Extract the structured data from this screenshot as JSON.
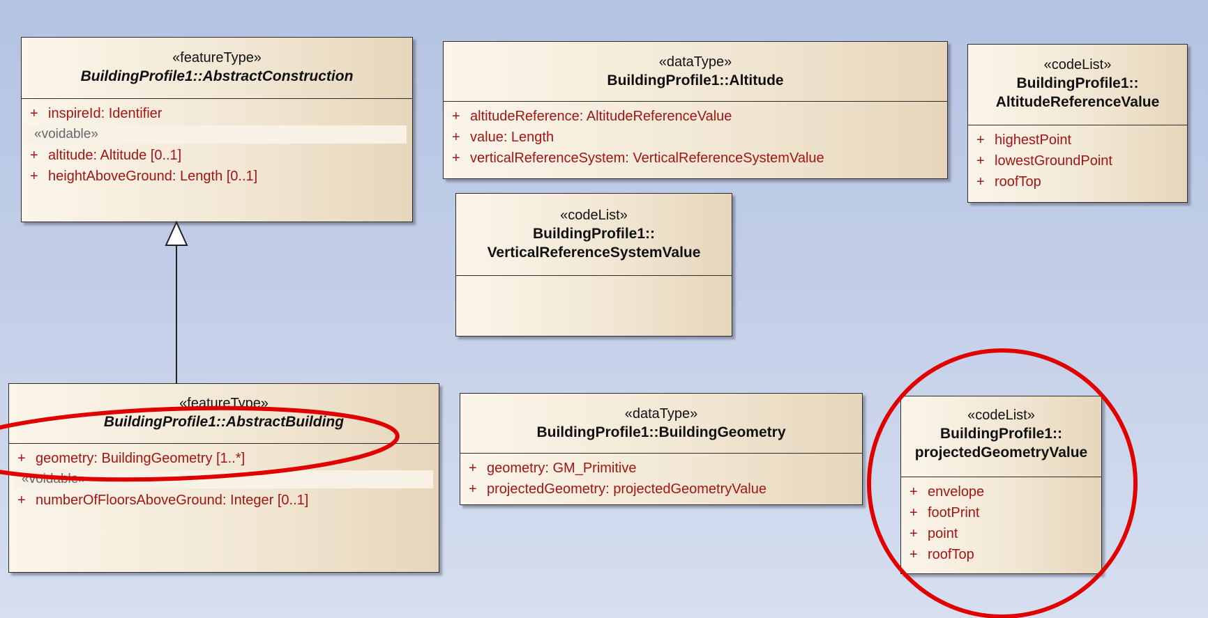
{
  "abstract_construction": {
    "stereotype": "«featureType»",
    "name": "BuildingProfile1::AbstractConstruction",
    "attr1": "inspireId: Identifier",
    "voidable": "«voidable»",
    "attr2": "altitude: Altitude [0..1]",
    "attr3": "heightAboveGround: Length [0..1]"
  },
  "altitude": {
    "stereotype": "«dataType»",
    "name": "BuildingProfile1::Altitude",
    "attrs": [
      "altitudeReference: AltitudeReferenceValue",
      "value: Length",
      "verticalReferenceSystem: VerticalReferenceSystemValue"
    ]
  },
  "altitude_reference_value": {
    "stereotype": "«codeList»",
    "name_line1": "BuildingProfile1::",
    "name_line2": "AltitudeReferenceValue",
    "attrs": [
      "highestPoint",
      "lowestGroundPoint",
      "roofTop"
    ]
  },
  "vertical_reference_system_value": {
    "stereotype": "«codeList»",
    "name_line1": "BuildingProfile1::",
    "name_line2": "VerticalReferenceSystemValue"
  },
  "abstract_building": {
    "stereotype": "«featureType»",
    "name": "BuildingProfile1::AbstractBuilding",
    "attr1": "geometry: BuildingGeometry [1..*]",
    "voidable": "«voidable»",
    "attr2": "numberOfFloorsAboveGround: Integer [0..1]"
  },
  "building_geometry": {
    "stereotype": "«dataType»",
    "name": "BuildingProfile1::BuildingGeometry",
    "attrs": [
      "geometry: GM_Primitive",
      "projectedGeometry: projectedGeometryValue"
    ]
  },
  "projected_geometry_value": {
    "stereotype": "«codeList»",
    "name_line1": "BuildingProfile1::",
    "name_line2": "projectedGeometryValue",
    "attrs": [
      "envelope",
      "footPrint",
      "point",
      "roofTop"
    ]
  },
  "plus": "+",
  "colors": {
    "attribute": "#a31515",
    "annotation": "#e00000",
    "background": "#c2cee8"
  }
}
